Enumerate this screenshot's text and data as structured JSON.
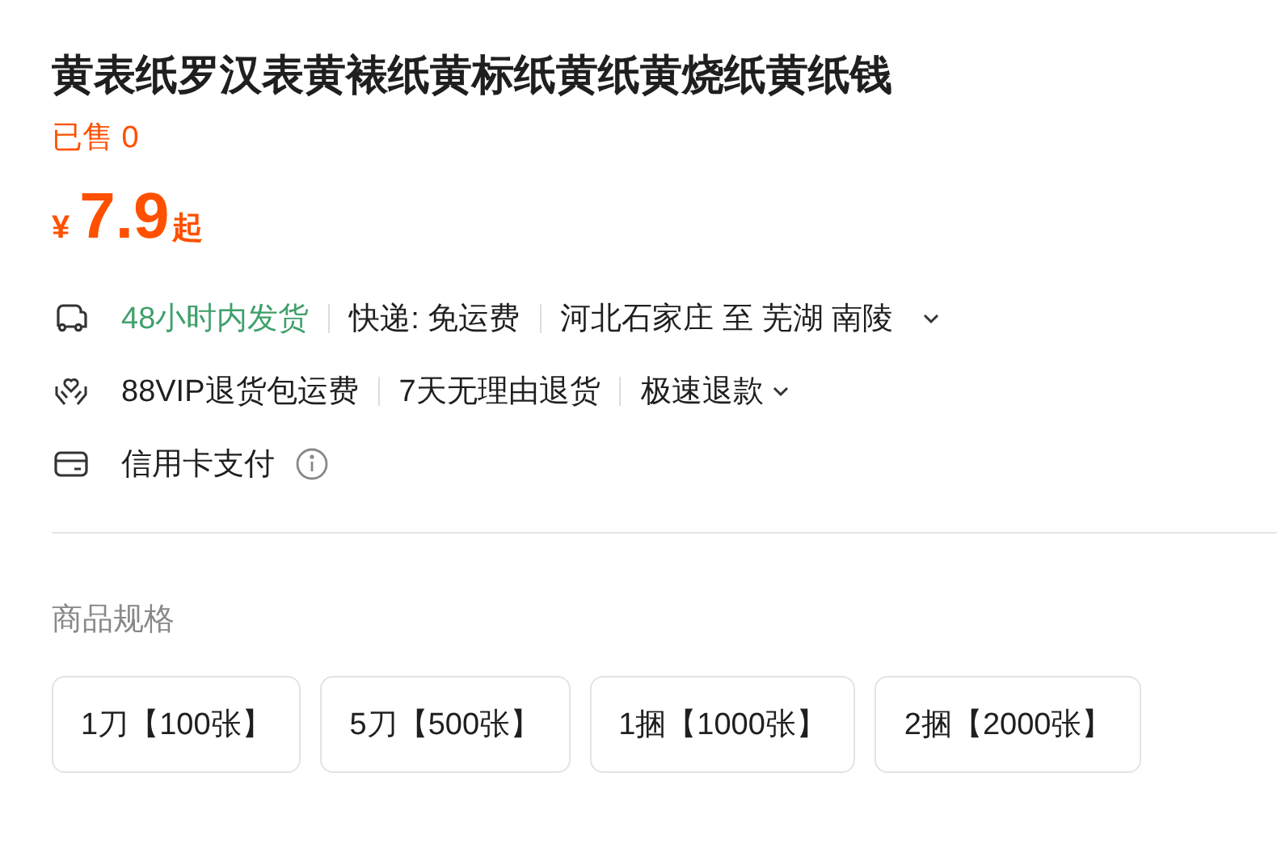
{
  "title": "黄表纸罗汉表黄裱纸黄标纸黄纸黄烧纸黄纸钱",
  "sold": "已售 0",
  "price": {
    "currency": "¥",
    "amount": "7.9",
    "suffix": "起"
  },
  "services": [
    {
      "kind": "shipping",
      "segments": [
        {
          "text": "48小时内发货",
          "highlight": true
        },
        {
          "text": "快递: 免运费",
          "highlight": false
        },
        {
          "text": "河北石家庄 至 芜湖 南陵",
          "highlight": false
        }
      ]
    },
    {
      "kind": "returns",
      "segments": [
        {
          "text": "88VIP退货包运费",
          "highlight": false
        },
        {
          "text": "7天无理由退货",
          "highlight": false
        },
        {
          "text": "极速退款",
          "highlight": false
        }
      ]
    },
    {
      "kind": "payment",
      "segments": [
        {
          "text": "信用卡支付",
          "highlight": false
        }
      ]
    }
  ],
  "spec": {
    "label": "商品规格",
    "options": [
      {
        "label": "1刀【100张】",
        "selected": false
      },
      {
        "label": "5刀【500张】",
        "selected": false
      },
      {
        "label": "1捆【1000张】",
        "selected": false
      },
      {
        "label": "2捆【2000张】",
        "selected": false
      }
    ]
  }
}
